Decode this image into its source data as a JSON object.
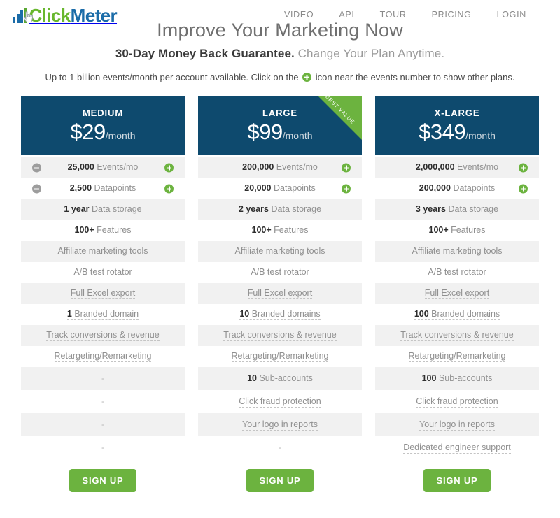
{
  "brand": {
    "name_part1": "Click",
    "name_part2": "Meter",
    "bars_icon": "bar-chart-icon",
    "cursor_icon": "cursor-hand-icon",
    "accent_green": "#68b72e",
    "accent_blue": "#1b6ca8"
  },
  "nav": {
    "items": [
      {
        "label": "VIDEO"
      },
      {
        "label": "API"
      },
      {
        "label": "TOUR"
      },
      {
        "label": "PRICING"
      },
      {
        "label": "LOGIN"
      }
    ]
  },
  "hero": {
    "title": "Improve Your Marketing Now",
    "subtitle_bold": "30-Day Money Back Guarantee.",
    "subtitle_light": "Change Your Plan Anytime.",
    "note_before": "Up to 1 billion events/month per account available. Click on the",
    "note_after": "icon near the events number to show other plans.",
    "note_icon": "plus-circle-icon"
  },
  "colors": {
    "card_header": "#0e4a6e",
    "green": "#6cb33f",
    "row_alt": "#f1f1f1",
    "minus": "#9d9d9d"
  },
  "ribbon": {
    "label": "BEST VALUE"
  },
  "cta": {
    "label": "SIGN UP"
  },
  "plans": [
    {
      "name": "MEDIUM",
      "price_amount": "$29",
      "price_period": "/month",
      "best_value": false,
      "has_minus": true,
      "rows": [
        {
          "value": "25,000",
          "label": "Events/mo",
          "stepper": true
        },
        {
          "value": "2,500",
          "label": "Datapoints",
          "stepper": true
        },
        {
          "value": "1 year",
          "label": "Data storage"
        },
        {
          "value": "100+",
          "label": "Features"
        },
        {
          "value": "",
          "label": "Affiliate marketing tools"
        },
        {
          "value": "",
          "label": "A/B test rotator"
        },
        {
          "value": "",
          "label": "Full Excel export"
        },
        {
          "value": "1",
          "label": "Branded domain"
        },
        {
          "value": "",
          "label": "Track conversions & revenue"
        },
        {
          "value": "",
          "label": "Retargeting/Remarketing"
        },
        {
          "value": "",
          "label": "-",
          "empty": true
        },
        {
          "value": "",
          "label": "-",
          "empty": true
        },
        {
          "value": "",
          "label": "-",
          "empty": true
        },
        {
          "value": "",
          "label": "-",
          "empty": true
        }
      ]
    },
    {
      "name": "LARGE",
      "price_amount": "$99",
      "price_period": "/month",
      "best_value": true,
      "has_minus": false,
      "rows": [
        {
          "value": "200,000",
          "label": "Events/mo",
          "stepper": true
        },
        {
          "value": "20,000",
          "label": "Datapoints",
          "stepper": true
        },
        {
          "value": "2 years",
          "label": "Data storage"
        },
        {
          "value": "100+",
          "label": "Features"
        },
        {
          "value": "",
          "label": "Affiliate marketing tools"
        },
        {
          "value": "",
          "label": "A/B test rotator"
        },
        {
          "value": "",
          "label": "Full Excel export"
        },
        {
          "value": "10",
          "label": "Branded domains"
        },
        {
          "value": "",
          "label": "Track conversions & revenue"
        },
        {
          "value": "",
          "label": "Retargeting/Remarketing"
        },
        {
          "value": "10",
          "label": "Sub-accounts"
        },
        {
          "value": "",
          "label": "Click fraud protection"
        },
        {
          "value": "",
          "label": "Your logo in reports"
        },
        {
          "value": "",
          "label": "-",
          "empty": true
        }
      ]
    },
    {
      "name": "X-LARGE",
      "price_amount": "$349",
      "price_period": "/month",
      "best_value": false,
      "has_minus": false,
      "rows": [
        {
          "value": "2,000,000",
          "label": "Events/mo",
          "stepper": true
        },
        {
          "value": "200,000",
          "label": "Datapoints",
          "stepper": true
        },
        {
          "value": "3 years",
          "label": "Data storage"
        },
        {
          "value": "100+",
          "label": "Features"
        },
        {
          "value": "",
          "label": "Affiliate marketing tools"
        },
        {
          "value": "",
          "label": "A/B test rotator"
        },
        {
          "value": "",
          "label": "Full Excel export"
        },
        {
          "value": "100",
          "label": "Branded domains"
        },
        {
          "value": "",
          "label": "Track conversions & revenue"
        },
        {
          "value": "",
          "label": "Retargeting/Remarketing"
        },
        {
          "value": "100",
          "label": "Sub-accounts"
        },
        {
          "value": "",
          "label": "Click fraud protection"
        },
        {
          "value": "",
          "label": "Your logo in reports"
        },
        {
          "value": "",
          "label": "Dedicated engineer support"
        }
      ]
    }
  ]
}
